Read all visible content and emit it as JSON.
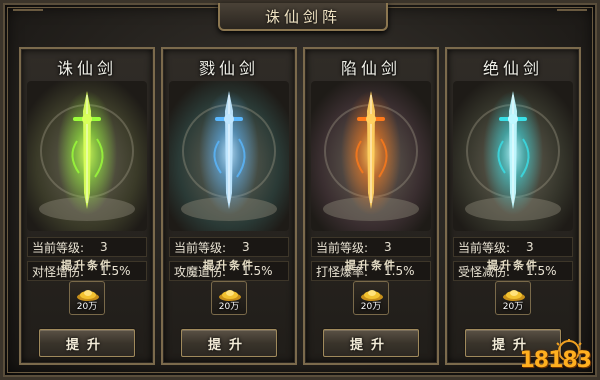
{
  "window": {
    "title": "诛仙剑阵"
  },
  "panels": [
    {
      "name": "诛仙剑",
      "level_label": "当前等级:",
      "level_value": "3",
      "stat_label": "对怪增伤:",
      "stat_value": "1.5%",
      "cond_label": "提升条件",
      "cost": "20万",
      "button_label": "提升",
      "glow_color": "#9cff3a",
      "sword_color": "#d8ff5a",
      "bg_tint": "#3a3a28"
    },
    {
      "name": "戮仙剑",
      "level_label": "当前等级:",
      "level_value": "3",
      "stat_label": "攻魔道伤:",
      "stat_value": "1.5%",
      "cond_label": "提升条件",
      "cost": "20万",
      "button_label": "提升",
      "glow_color": "#5ab8ff",
      "sword_color": "#bfe6ff",
      "bg_tint": "#2a3a36"
    },
    {
      "name": "陷仙剑",
      "level_label": "当前等级:",
      "level_value": "3",
      "stat_label": "打怪爆率:",
      "stat_value": "1.5%",
      "cond_label": "提升条件",
      "cost": "20万",
      "button_label": "提升",
      "glow_color": "#ff7a1a",
      "sword_color": "#ffd060",
      "bg_tint": "#3a2e30"
    },
    {
      "name": "绝仙剑",
      "level_label": "当前等级:",
      "level_value": "3",
      "stat_label": "受怪减伤:",
      "stat_value": "1.5%",
      "cond_label": "提升条件",
      "cost": "20万",
      "button_label": "提升",
      "glow_color": "#3ae0e8",
      "sword_color": "#bff8ff",
      "bg_tint": "#34342a"
    }
  ],
  "watermark": {
    "text": "18183"
  },
  "colors": {
    "frame_gold": "#8b7650",
    "text_light": "#efe2c2",
    "gold_coin": "#f2c230"
  }
}
